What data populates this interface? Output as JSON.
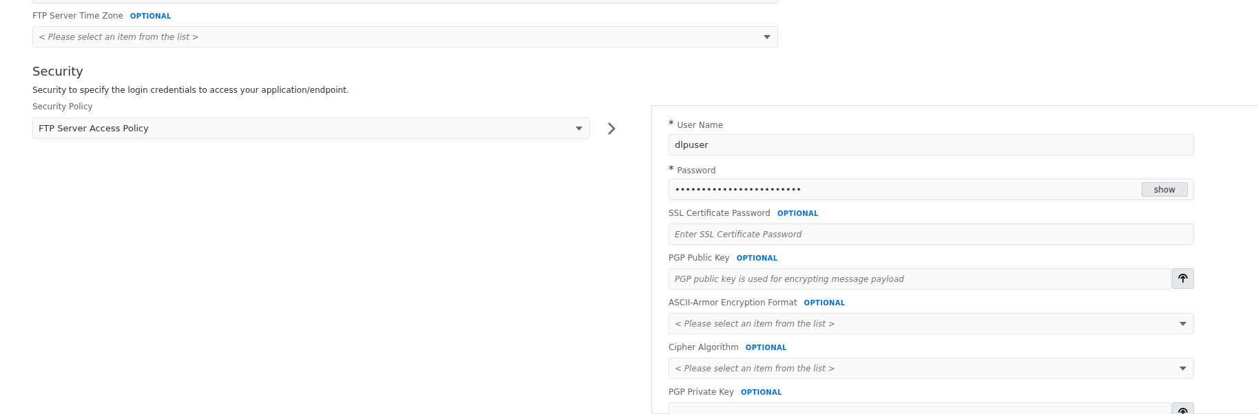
{
  "connection": {
    "fields": [
      {
        "kind": "select",
        "label": "FTP Server Time Zone",
        "optional_tag": "OPTIONAL",
        "placeholder": "< Please select an item from the list >"
      }
    ]
  },
  "security": {
    "heading": "Security",
    "description": "Security to specify the login credentials to access your application/endpoint.",
    "policy": {
      "label": "Security Policy",
      "value": "FTP Server Access Policy"
    },
    "fields": [
      {
        "kind": "text",
        "label": "User Name",
        "required_mark": "*",
        "value": "dlpuser"
      },
      {
        "kind": "password",
        "label": "Password",
        "required_mark": "*",
        "value": "••••••••••••••••••••••••",
        "button": "show"
      },
      {
        "kind": "text",
        "label": "SSL Certificate Password",
        "optional_tag": "OPTIONAL",
        "placeholder": "Enter SSL Certificate Password"
      },
      {
        "kind": "file",
        "label": "PGP Public Key",
        "optional_tag": "OPTIONAL",
        "placeholder": "PGP public key is used for encrypting message payload"
      },
      {
        "kind": "select",
        "label": "ASCII-Armor Encryption Format",
        "optional_tag": "OPTIONAL",
        "placeholder": "< Please select an item from the list >"
      },
      {
        "kind": "select",
        "label": "Cipher Algorithm",
        "optional_tag": "OPTIONAL",
        "placeholder": "< Please select an item from the list >"
      },
      {
        "kind": "file",
        "label": "PGP Private Key",
        "optional_tag": "OPTIONAL"
      }
    ]
  }
}
